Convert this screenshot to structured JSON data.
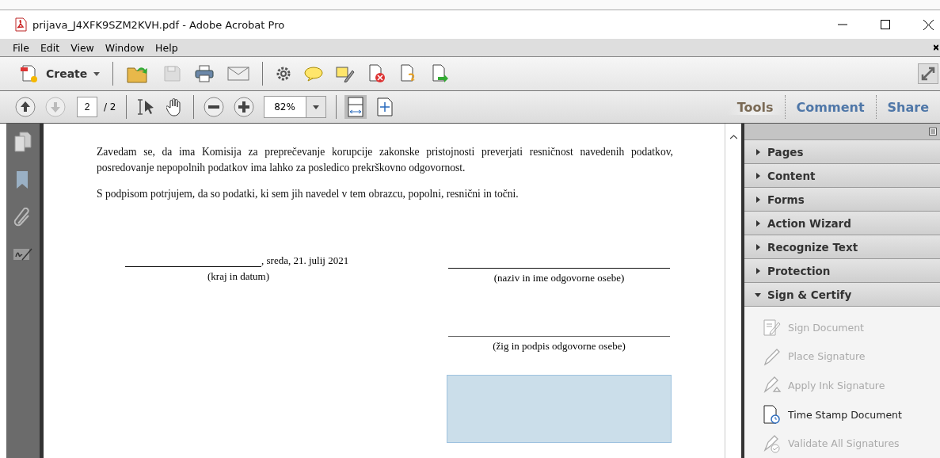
{
  "window": {
    "title": "prijava_J4XFK9SZM2KVH.pdf - Adobe Acrobat Pro"
  },
  "menu": [
    "File",
    "Edit",
    "View",
    "Window",
    "Help"
  ],
  "toolbar": {
    "create_label": "Create"
  },
  "navigation": {
    "page": "2",
    "total": "/ 2",
    "zoom": "82%"
  },
  "panel_tabs": [
    {
      "label": "Tools",
      "selected": true
    },
    {
      "label": "Comment",
      "selected": false
    },
    {
      "label": "Share",
      "selected": false
    }
  ],
  "document": {
    "paragraphs": [
      "Zavedam se, da ima Komisija za preprečevanje korupcije zakonske pristojnosti preverjati resničnost navedenih podatkov, posredovanje nepopolnih podatkov ima lahko za posledico prekrškovno odgovornost.",
      "S podpisom potrjujem, da so podatki, ki sem jih navedel v tem obrazcu, popolni, resnični in točni."
    ],
    "date_text": ", sreda, 21. julij 2021",
    "place_caption": "(kraj in datum)",
    "name_caption": "(naziv in ime odgovorne osebe)",
    "stamp_caption": "(žig in podpis odgovorne osebe)"
  },
  "tools_panel": {
    "sections": [
      {
        "label": "Pages",
        "expanded": false
      },
      {
        "label": "Content",
        "expanded": false
      },
      {
        "label": "Forms",
        "expanded": false
      },
      {
        "label": "Action Wizard",
        "expanded": false
      },
      {
        "label": "Recognize Text",
        "expanded": false
      },
      {
        "label": "Protection",
        "expanded": false
      },
      {
        "label": "Sign & Certify",
        "expanded": true
      }
    ],
    "items": [
      {
        "label": "Sign Document",
        "kind": "sign",
        "disabled": true
      },
      {
        "label": "Place Signature",
        "kind": "pen",
        "disabled": true
      },
      {
        "label": "Apply Ink Signature",
        "kind": "ink",
        "disabled": true
      },
      {
        "label": "Time Stamp Document",
        "kind": "stamp",
        "disabled": false
      },
      {
        "label": "Validate All Signatures",
        "kind": "validate",
        "disabled": true
      }
    ]
  }
}
